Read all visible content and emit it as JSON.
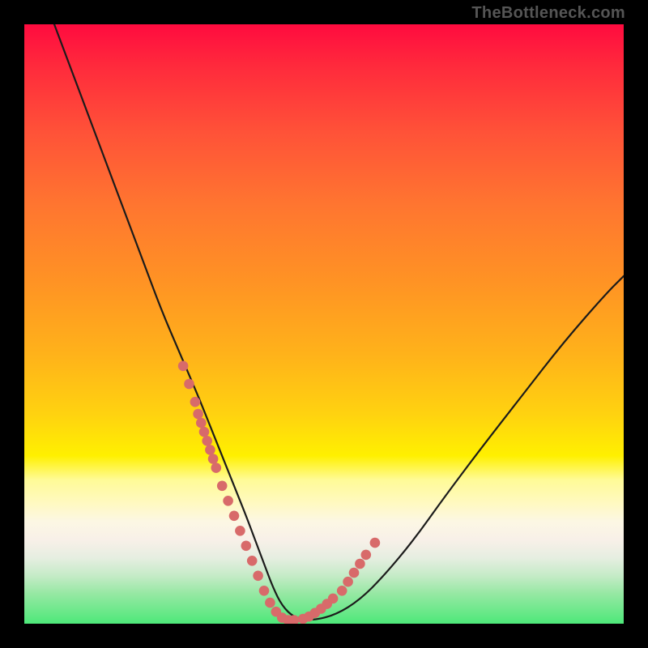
{
  "attribution": "TheBottleneck.com",
  "colors": {
    "curve_stroke": "#1b1b1b",
    "marker_fill": "#d86a6a",
    "frame_bg": "#000000"
  },
  "chart_data": {
    "type": "line",
    "title": "",
    "xlabel": "",
    "ylabel": "",
    "xlim": [
      0,
      100
    ],
    "ylim": [
      0,
      100
    ],
    "series": [
      {
        "name": "bottleneck-curve",
        "x": [
          5,
          8,
          11,
          14,
          17,
          20,
          23,
          26,
          29,
          31,
          33,
          35,
          37,
          38.5,
          40,
          41.5,
          43,
          45,
          48,
          52,
          56,
          60,
          65,
          70,
          76,
          83,
          90,
          97,
          100
        ],
        "values": [
          100,
          92,
          84,
          76,
          68,
          60,
          52,
          45,
          38,
          33,
          28,
          23,
          18,
          14,
          10,
          6,
          3,
          1,
          0.5,
          1.5,
          4,
          8,
          14,
          21,
          29,
          38,
          47,
          55,
          58
        ]
      }
    ],
    "markers": {
      "name": "data-points",
      "x": [
        26.5,
        27.5,
        28.5,
        29,
        29.5,
        30,
        30.5,
        31,
        31.5,
        32,
        33,
        34,
        35,
        36,
        37,
        38,
        39,
        40,
        41,
        42,
        43,
        44,
        45,
        46.5,
        47.5,
        48.5,
        49.5,
        50.5,
        51.5,
        53,
        54,
        55,
        56,
        57,
        58.5
      ],
      "y": [
        43,
        40,
        37,
        35,
        33.5,
        32,
        30.5,
        29,
        27.5,
        26,
        23,
        20.5,
        18,
        15.5,
        13,
        10.5,
        8,
        5.5,
        3.5,
        2,
        1,
        0.6,
        0.6,
        0.8,
        1.2,
        1.8,
        2.5,
        3.3,
        4.2,
        5.5,
        7,
        8.5,
        10,
        11.5,
        13.5
      ]
    }
  }
}
